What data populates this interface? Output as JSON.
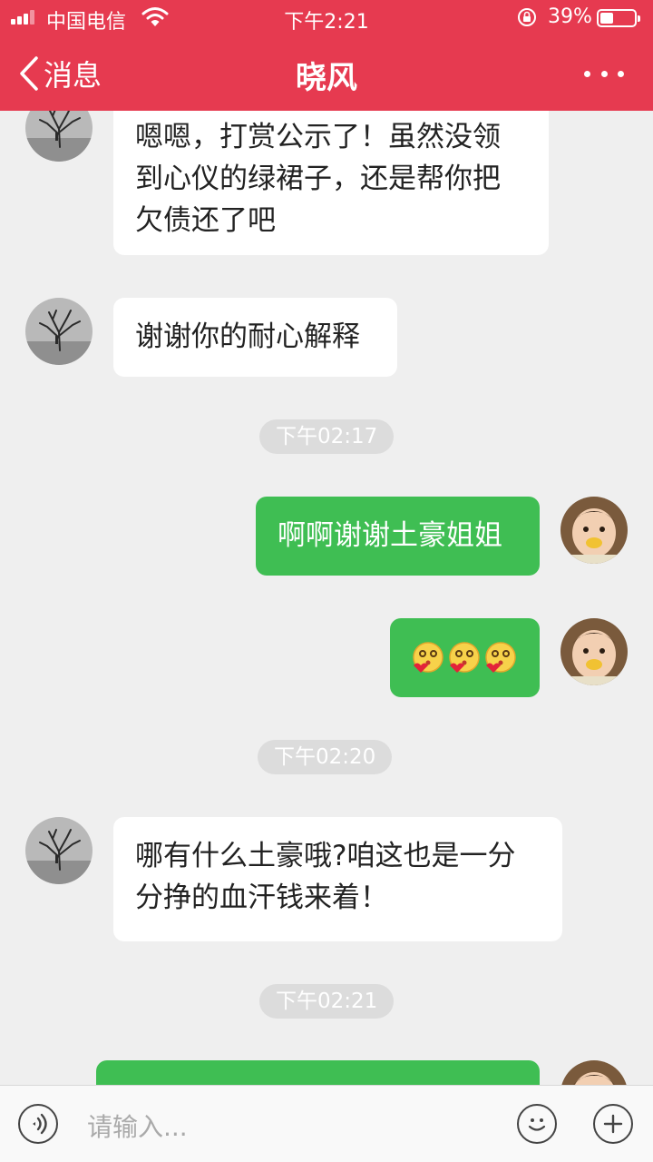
{
  "status_bar": {
    "carrier": "中国电信",
    "time": "下午2:21",
    "battery_percent": "39%",
    "battery_level": 0.39,
    "icons": [
      "signal-icon",
      "wifi-icon",
      "rotation-lock-icon",
      "battery-icon"
    ]
  },
  "nav": {
    "back_label": "消息",
    "title": "晓风",
    "icons": [
      "chevron-left-icon",
      "more-icon"
    ]
  },
  "messages": [
    {
      "side": "in",
      "lines": [
        "嗯嗯，打赏公示了！虽然没领",
        "到心仪的绿裙子，还是帮你把",
        "欠债还了吧"
      ]
    },
    {
      "side": "in",
      "lines": [
        "谢谢你的耐心解释"
      ]
    },
    {
      "timestamp": "下午02:17"
    },
    {
      "side": "out",
      "lines": [
        "啊啊谢谢土豪姐姐"
      ]
    },
    {
      "side": "out",
      "emoji": [
        "kiss-emoji-icon",
        "kiss-emoji-icon",
        "kiss-emoji-icon"
      ]
    },
    {
      "timestamp": "下午02:20"
    },
    {
      "side": "in",
      "lines": [
        "哪有什么土豪哦?咱这也是一分",
        "分挣的血汗钱来着！"
      ]
    },
    {
      "timestamp": "下午02:21"
    },
    {
      "side": "out",
      "partial": true
    }
  ],
  "input_bar": {
    "placeholder": "请输入...",
    "icons": [
      "voice-icon",
      "emoji-icon",
      "plus-icon"
    ]
  },
  "colors": {
    "header": "#e63a50",
    "background": "#efefef",
    "incoming_bubble": "#ffffff",
    "outgoing_bubble": "#3fbe53",
    "timestamp_pill": "#dcdcdc"
  }
}
